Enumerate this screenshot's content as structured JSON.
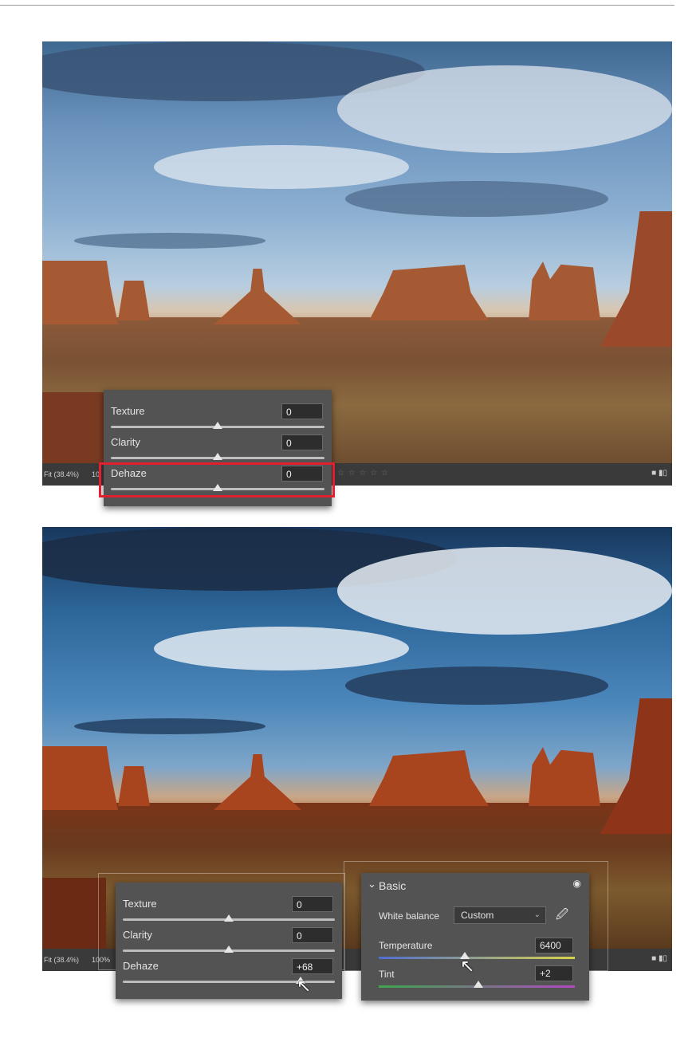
{
  "top_screenshot": {
    "statusbar": {
      "zoom": "Fit (38.4%)",
      "zoom_100": "10",
      "stars": "☆ ☆ ☆ ☆ ☆",
      "icons": "■ ▮▯"
    },
    "panel": {
      "rows": [
        {
          "label": "Texture",
          "value": "0",
          "fraction": 0.5
        },
        {
          "label": "Clarity",
          "value": "0",
          "fraction": 0.5
        },
        {
          "label": "Dehaze",
          "value": "0",
          "fraction": 0.5
        }
      ]
    },
    "highlight_color": "#e0202e"
  },
  "bottom_screenshot": {
    "statusbar": {
      "zoom": "Fit (38.4%)",
      "zoom_100": "100%",
      "icons": "■ ▮▯"
    },
    "panel": {
      "rows": [
        {
          "label": "Texture",
          "value": "0",
          "fraction": 0.5
        },
        {
          "label": "Clarity",
          "value": "0",
          "fraction": 0.5
        },
        {
          "label": "Dehaze",
          "value": "+68",
          "fraction": 0.84
        }
      ]
    },
    "basic_panel": {
      "title": "Basic",
      "chevron": "⌄",
      "eye_icon": "◉",
      "white_balance_label": "White balance",
      "white_balance_value": "Custom",
      "temperature_label": "Temperature",
      "temperature_value": "6400",
      "temperature_fraction": 0.44,
      "tint_label": "Tint",
      "tint_value": "+2",
      "tint_fraction": 0.51
    }
  },
  "cursor_glyph": "↖"
}
